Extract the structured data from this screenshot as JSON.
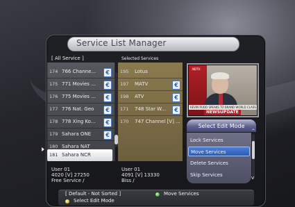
{
  "title": "Service List Manager",
  "left_header": "[ All Service ]",
  "right_header": "Selected Services",
  "left_list": [
    {
      "num": "174",
      "name": "766 Channe...",
      "scrambled": true
    },
    {
      "num": "175",
      "name": "771 Movies ...",
      "scrambled": true
    },
    {
      "num": "176",
      "name": "775 Movies ...",
      "scrambled": true
    },
    {
      "num": "177",
      "name": "776 Nat. Geo",
      "scrambled": true
    },
    {
      "num": "178",
      "name": "778 Xing Ko...",
      "scrambled": true
    },
    {
      "num": "179",
      "name": "Sahara ONE",
      "scrambled": true
    },
    {
      "num": "180",
      "name": "Sahara NAT",
      "scrambled": false
    },
    {
      "num": "181",
      "name": "Sahara NCR",
      "scrambled": false,
      "selected": true
    }
  ],
  "right_list": [
    {
      "num": "195",
      "name": "Lotus",
      "scrambled": false
    },
    {
      "num": "197",
      "name": "MATV",
      "scrambled": true
    },
    {
      "num": "198",
      "name": "ATV",
      "scrambled": true
    },
    {
      "num": "171",
      "name": "748 Star W...",
      "scrambled": true
    },
    {
      "num": "170",
      "name": "747 Channel [V] ...",
      "scrambled": false
    }
  ],
  "left_info": {
    "line1": "User 01",
    "line2": "4020 [V] 27250",
    "line3": "Free Service /"
  },
  "right_info": {
    "line1": "User 01",
    "line2": "4091 [V] 13330",
    "line3": "Biss /"
  },
  "preview": {
    "ticker": "KEVIN RUDD SPEAKS TO BRAND WORLD CLASS",
    "badge": "NEWSUPDATE",
    "logo": "NDTV"
  },
  "edit_mode": {
    "title": "Select Edit Mode",
    "items": [
      "Lock Services",
      "Move Services",
      "Delete Services",
      "Skip Services"
    ],
    "active_index": 1
  },
  "footer": {
    "sort_label": "[ Default - Not Sorted ]",
    "move_label": "Move Services",
    "select_label": "Select Edit Mode"
  },
  "colors": {
    "accent": "#2c5bb3",
    "selected_list_bg": "#8b7a4f",
    "green_key": "#34a82b",
    "yellow_key": "#d7b417"
  }
}
